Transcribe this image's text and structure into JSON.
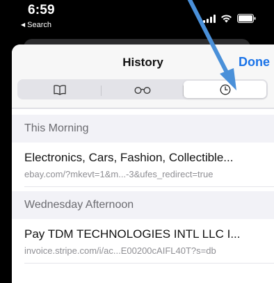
{
  "status_bar": {
    "time": "6:59",
    "back_app_label": "Search",
    "icons": [
      "signal-icon",
      "wifi-icon",
      "battery-icon"
    ]
  },
  "header": {
    "title": "History",
    "done_label": "Done"
  },
  "segments": [
    {
      "icon": "book-icon",
      "selected": false
    },
    {
      "icon": "reading-list-glasses-icon",
      "selected": false
    },
    {
      "icon": "history-clock-icon",
      "selected": true
    }
  ],
  "sections": [
    {
      "title": "This Morning",
      "items": [
        {
          "title": "Electronics, Cars, Fashion, Collectible...",
          "url": "ebay.com/?mkevt=1&m...-3&ufes_redirect=true"
        }
      ]
    },
    {
      "title": "Wednesday Afternoon",
      "items": [
        {
          "title": "Pay TDM TECHNOLOGIES INTL LLC I...",
          "url": "invoice.stripe.com/i/ac...E00200cAIFL40T?s=db"
        }
      ]
    }
  ],
  "colors": {
    "accent": "#1a73e8",
    "arrow": "#4a90d9",
    "sheet_bg": "#f2f2f7"
  }
}
